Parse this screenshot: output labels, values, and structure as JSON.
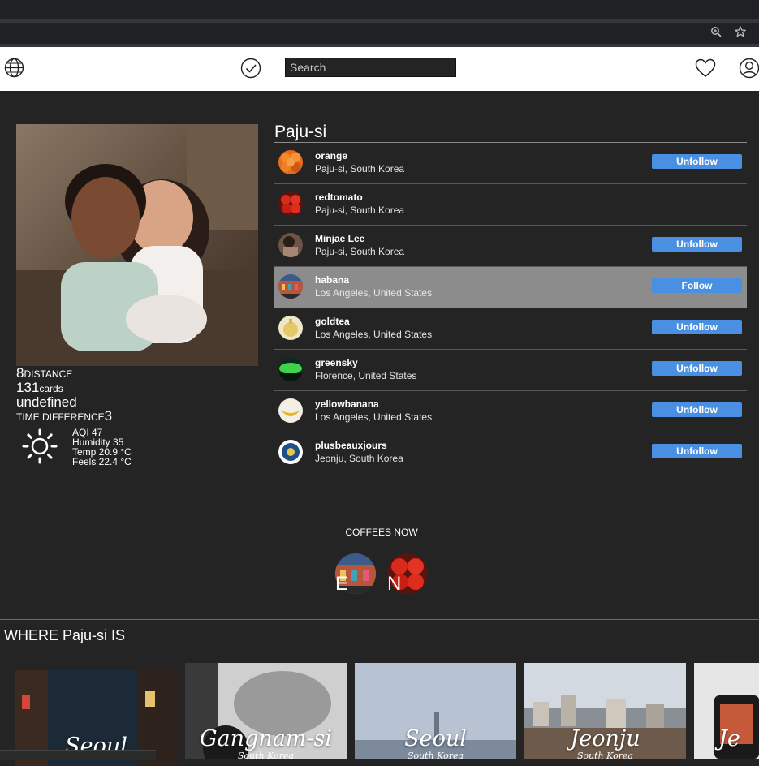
{
  "header": {
    "search_placeholder": "Search"
  },
  "stats": {
    "distance_value": "8",
    "distance_label": "DISTANCE",
    "cards_value": "131",
    "cards_label": "cards",
    "undefined_text": "undefined",
    "time_label": "TIME DIFFERENCE",
    "time_value": "3",
    "weather": {
      "aqi": "AQI 47",
      "humidity": "Humidity 35",
      "temp": "Temp 20.9 °C",
      "feels": "Feels 22.4 °C"
    }
  },
  "list": {
    "city_title": "Paju-si",
    "users": [
      {
        "name": "orange",
        "location": "Paju-si, South Korea",
        "button": "Unfollow"
      },
      {
        "name": "redtomato",
        "location": "Paju-si, South Korea",
        "button": ""
      },
      {
        "name": "Minjae Lee",
        "location": "Paju-si, South Korea",
        "button": "Unfollow"
      },
      {
        "name": "habana",
        "location": "Los Angeles, United States",
        "button": "Follow"
      },
      {
        "name": "goldtea",
        "location": "Los Angeles, United States",
        "button": "Unfollow"
      },
      {
        "name": "greensky",
        "location": "Florence, United States",
        "button": "Unfollow"
      },
      {
        "name": "yellowbanana",
        "location": "Los Angeles, United States",
        "button": "Unfollow"
      },
      {
        "name": "plusbeauxjours",
        "location": "Jeonju, South Korea",
        "button": "Unfollow"
      }
    ]
  },
  "coffees": {
    "title": "COFFEES NOW",
    "items": [
      {
        "letter": "E"
      },
      {
        "letter": "N"
      }
    ]
  },
  "where": {
    "title": "WHERE Paju-si IS",
    "cards": [
      {
        "name": "Seoul",
        "sub": ""
      },
      {
        "name": "Gangnam-si",
        "sub": "South Korea"
      },
      {
        "name": "Seoul",
        "sub": "South Korea"
      },
      {
        "name": "Jeonju",
        "sub": "South Korea"
      },
      {
        "name": "Je",
        "sub": ""
      }
    ]
  },
  "colors": {
    "accent": "#4a90e2",
    "background": "#242424",
    "highlight_row": "#8c8c8c"
  }
}
